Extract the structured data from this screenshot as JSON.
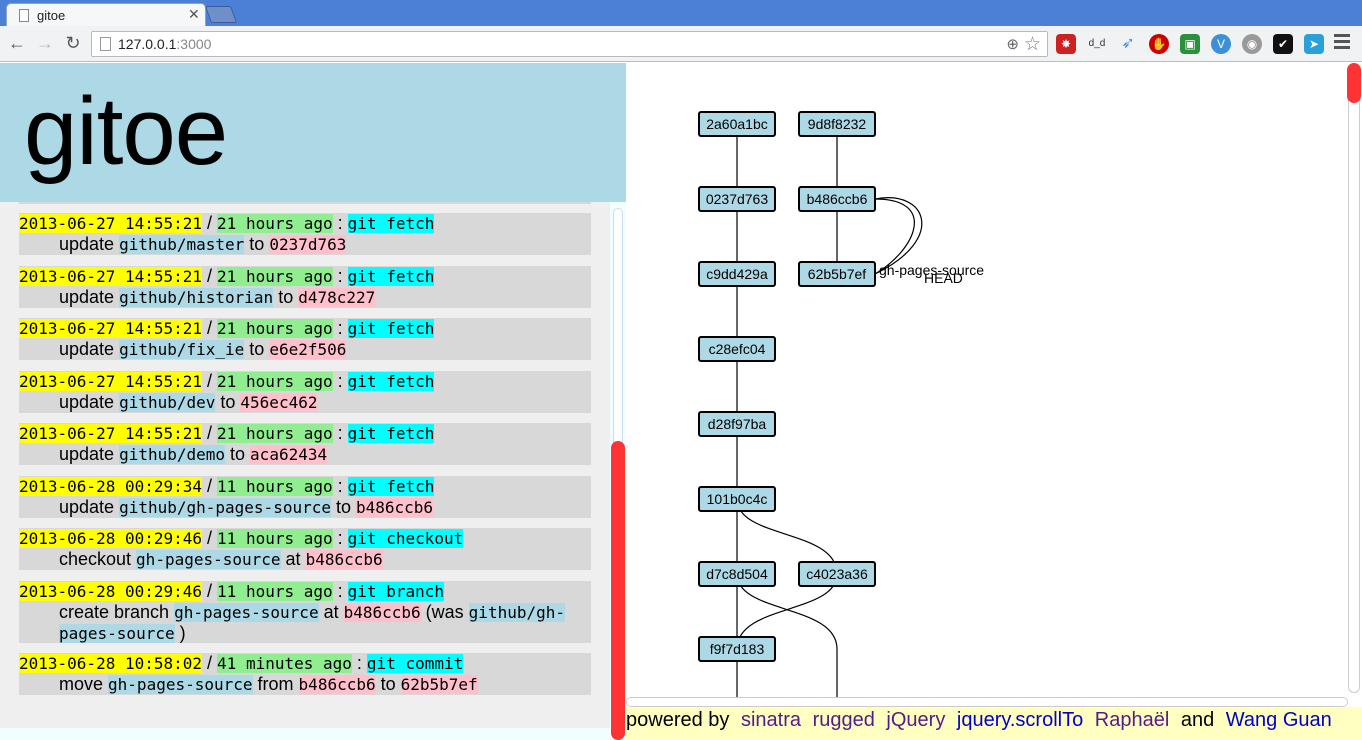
{
  "browser": {
    "tab_title": "gitoe",
    "url_host": "127.0.0.1",
    "url_port": ":3000",
    "extensions": [
      "lastpass-icon",
      "dd-icon",
      "twitter-icon",
      "adblock-icon",
      "drive-icon",
      "vimium-icon",
      "chrome-icon",
      "checkmark-icon",
      "tag-icon"
    ]
  },
  "header": {
    "title": "gitoe"
  },
  "log": [
    {
      "date": "2013-06-27 14:55:21",
      "ago": "21 hours ago",
      "cmd": "git fetch",
      "parts": [
        "update ",
        "github/master",
        " to ",
        "0237d763"
      ]
    },
    {
      "date": "2013-06-27 14:55:21",
      "ago": "21 hours ago",
      "cmd": "git fetch",
      "parts": [
        "update ",
        "github/historian",
        " to ",
        "d478c227"
      ]
    },
    {
      "date": "2013-06-27 14:55:21",
      "ago": "21 hours ago",
      "cmd": "git fetch",
      "parts": [
        "update ",
        "github/fix_ie",
        " to ",
        "e6e2f506"
      ]
    },
    {
      "date": "2013-06-27 14:55:21",
      "ago": "21 hours ago",
      "cmd": "git fetch",
      "parts": [
        "update ",
        "github/dev",
        " to ",
        "456ec462"
      ]
    },
    {
      "date": "2013-06-27 14:55:21",
      "ago": "21 hours ago",
      "cmd": "git fetch",
      "parts": [
        "update ",
        "github/demo",
        " to ",
        "aca62434"
      ]
    },
    {
      "date": "2013-06-28 00:29:34",
      "ago": "11 hours ago",
      "cmd": "git fetch",
      "parts": [
        "update ",
        "github/gh-pages-source",
        " to ",
        "b486ccb6"
      ]
    },
    {
      "date": "2013-06-28 00:29:46",
      "ago": "11 hours ago",
      "cmd": "git checkout",
      "parts": [
        "checkout ",
        "gh-pages-source",
        " at ",
        "b486ccb6"
      ]
    },
    {
      "date": "2013-06-28 00:29:46",
      "ago": "11 hours ago",
      "cmd": "git branch",
      "parts": [
        "create branch ",
        "gh-pages-source",
        " at ",
        "b486ccb6",
        " (was ",
        "github/gh-pages-source",
        " )"
      ]
    },
    {
      "date": "2013-06-28 10:58:02",
      "ago": "41 minutes ago",
      "cmd": "git commit",
      "parts": [
        "move ",
        "gh-pages-source",
        " from ",
        "b486ccb6",
        " to ",
        "62b5b7ef"
      ]
    }
  ],
  "separators": {
    "slash": " / ",
    "colon": " : "
  },
  "graph": {
    "commits": [
      {
        "sha": "2a60a1bc",
        "col": 0,
        "row": 0
      },
      {
        "sha": "9d8f8232",
        "col": 1,
        "row": 0
      },
      {
        "sha": "0237d763",
        "col": 0,
        "row": 1
      },
      {
        "sha": "b486ccb6",
        "col": 1,
        "row": 1
      },
      {
        "sha": "c9dd429a",
        "col": 0,
        "row": 2
      },
      {
        "sha": "62b5b7ef",
        "col": 1,
        "row": 2
      },
      {
        "sha": "c28efc04",
        "col": 0,
        "row": 3
      },
      {
        "sha": "d28f97ba",
        "col": 0,
        "row": 4
      },
      {
        "sha": "101b0c4c",
        "col": 0,
        "row": 5
      },
      {
        "sha": "d7c8d504",
        "col": 0,
        "row": 6
      },
      {
        "sha": "c4023a36",
        "col": 1,
        "row": 6
      },
      {
        "sha": "f9f7d183",
        "col": 0,
        "row": 7
      }
    ],
    "labels": {
      "branch": "gh-pages-source",
      "head": "HEAD"
    }
  },
  "footer": {
    "prefix": "powered by",
    "links": [
      "sinatra",
      "rugged",
      "jQuery",
      "jquery.scrollTo",
      "Raphaël"
    ],
    "and": "and",
    "author": "Wang Guan"
  },
  "colors": {
    "header_bg": "#add8e6",
    "date": "#ffff00",
    "ago": "#90ee90",
    "cmd": "#00ffff",
    "ref": "#add8e6",
    "sha": "#ffc0cb",
    "scroll_thumb": "#ff3333",
    "footer_bg": "#ffffc0"
  }
}
